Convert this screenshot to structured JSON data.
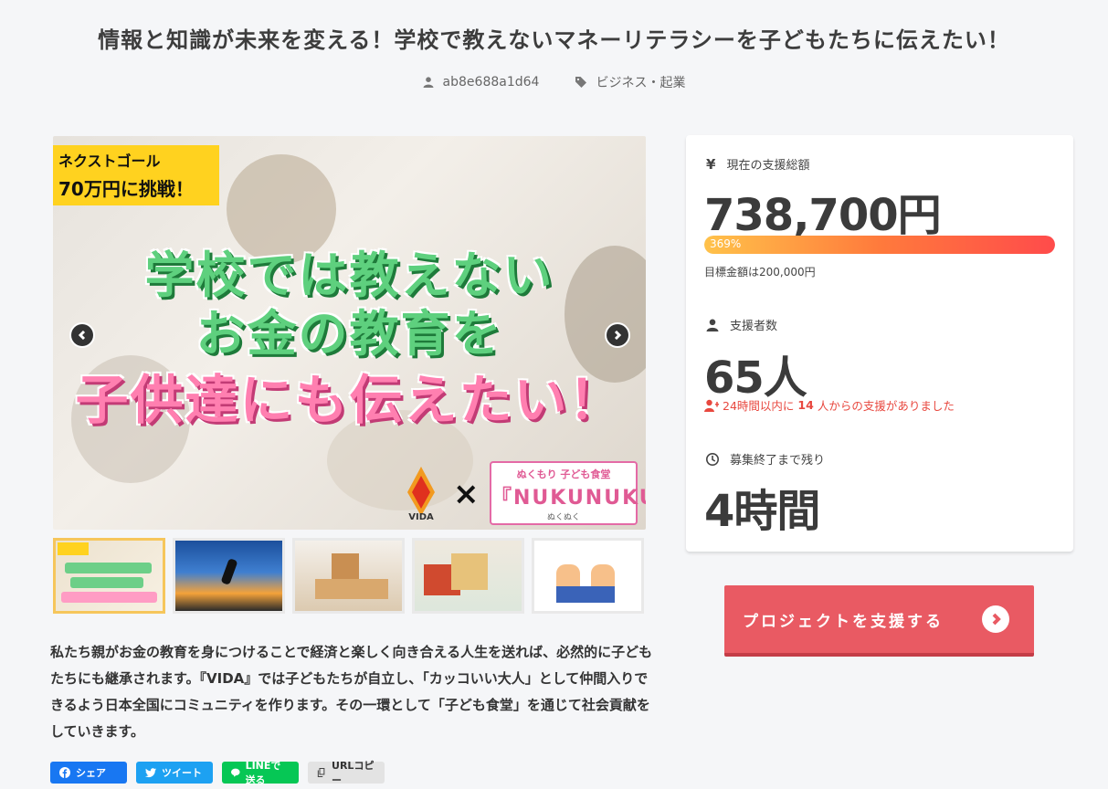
{
  "project": {
    "title": "情報と知識が未来を変える！学校で教えないマネーリテラシーを子どもたちに伝えたい！",
    "author": "ab8e688a1d64",
    "category": "ビジネス・起業"
  },
  "hero": {
    "goal_line1": "ネクストゴール",
    "goal_line2": "70万円に挑戦！",
    "headline1": "学校では教えない",
    "headline2": "お金の教育を",
    "headline3": "子供達にも伝えたい！",
    "vida_label": "VIDA",
    "times": "×",
    "nuku_top": "ぬくもり 子ども食堂",
    "nuku_main": "『NUKUNUKU』",
    "nuku_sub": "ぬくぬく"
  },
  "thumbnails": [
    {
      "name": "thumb-1",
      "active": true,
      "color": "#f0e2c2"
    },
    {
      "name": "thumb-2",
      "active": false,
      "color": "#2b5ea8"
    },
    {
      "name": "thumb-3",
      "active": false,
      "color": "#e3c9a5"
    },
    {
      "name": "thumb-4",
      "active": false,
      "color": "#e7ddc8"
    },
    {
      "name": "thumb-5",
      "active": false,
      "color": "#ffffff"
    }
  ],
  "description": "私たち親がお金の教育を身につけることで経済と楽しく向き合える人生を送れば、必然的に子どもたちにも継承されます。『VIDA』では子どもたちが自立し、「カッコいい大人」として仲間入りできるよう日本全国にコミュニティを作ります。その一環として「子ども食堂」を通じて社会貢献をしていきます。",
  "share": {
    "facebook": "シェア",
    "twitter": "ツイート",
    "line": "LINEで送る",
    "url": "URLコピー"
  },
  "stats": {
    "total_label": "現在の支援総額",
    "total_value": "738,700円",
    "progress_text": "369%",
    "progress_fraction": 1.0,
    "target_text": "目標金額は200,000円",
    "supporters_label": "支援者数",
    "supporters_value": "65人",
    "recent_prefix": "24時間以内に",
    "recent_count": "14",
    "recent_suffix": "人からの支援がありました",
    "remaining_label": "募集終了まで残り",
    "remaining_value": "4時間"
  },
  "cta": {
    "label": "プロジェクトを支援する"
  },
  "colors": {
    "accent": "#e95a63",
    "alert": "#e8483f",
    "progress_start": "#ffc24a",
    "progress_end": "#ff4b4b"
  }
}
